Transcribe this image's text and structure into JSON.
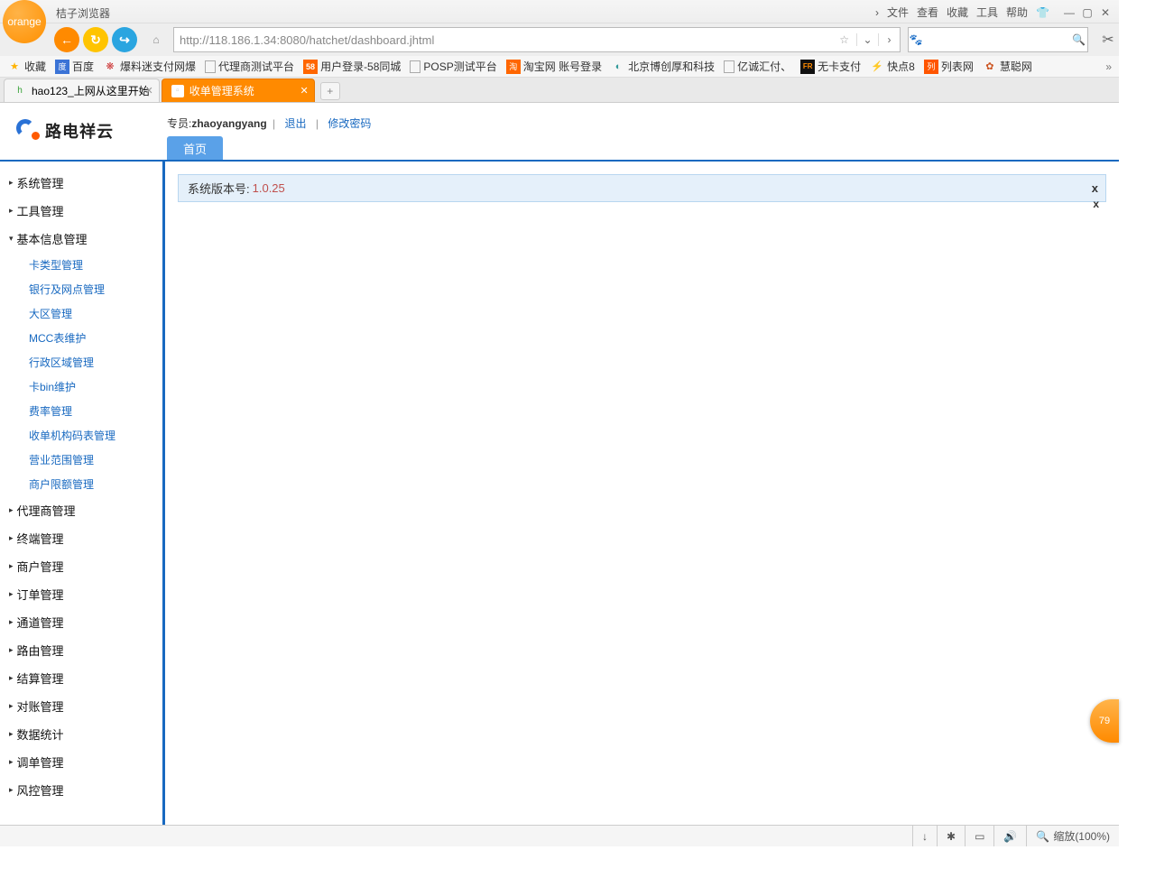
{
  "browser": {
    "name": "orange",
    "title": "桔子浏览器",
    "top_menu": [
      "文件",
      "查看",
      "收藏",
      "工具",
      "帮助"
    ],
    "url": "http://118.186.1.34:8080/hatchet/dashboard.jhtml",
    "url_display_prefix": "http://",
    "url_display_host": "118.186.1.34",
    "url_display_rest": ":8080/hatchet/dashboard.jhtml"
  },
  "bookmarks": {
    "fav_label": "收藏",
    "items": [
      {
        "label": "百度",
        "color": "#3b73d6"
      },
      {
        "label": "爆料迷支付网爆",
        "color": "#cc3333"
      },
      {
        "label": "代理商测试平台",
        "color": "#888"
      },
      {
        "label": "用户登录-58同城",
        "color": "#ff6600",
        "badge": "58"
      },
      {
        "label": "POSP测试平台",
        "color": "#888"
      },
      {
        "label": "淘宝网 账号登录",
        "color": "#ff6600",
        "badge": "淘"
      },
      {
        "label": "北京博创厚和科技",
        "color": "#339999"
      },
      {
        "label": "亿诚汇付、",
        "color": "#888"
      },
      {
        "label": "无卡支付",
        "color": "#222",
        "badge": "FR"
      },
      {
        "label": "快点8",
        "color": "#ff8800"
      },
      {
        "label": "列表网",
        "color": "#ff5500",
        "badge": "列"
      },
      {
        "label": "慧聪网",
        "color": "#cc5522"
      }
    ]
  },
  "tabs": [
    {
      "label": "hao123_上网从这里开始",
      "active": false,
      "favcolor": "#3aa33a"
    },
    {
      "label": "收单管理系统",
      "active": true,
      "favcolor": "#ffffff"
    }
  ],
  "app": {
    "logo_text": "路电祥云",
    "user_prefix": "专员:",
    "username": "zhaoyangyang",
    "logout": "退出",
    "change_pwd": "修改密码",
    "home_tab": "首页",
    "version_label": "系统版本号:",
    "version_value": " 1.0.25",
    "close_x": "x"
  },
  "sidebar": [
    {
      "label": "系统管理",
      "expanded": false
    },
    {
      "label": "工具管理",
      "expanded": false
    },
    {
      "label": "基本信息管理",
      "expanded": true,
      "children": [
        "卡类型管理",
        "银行及网点管理",
        "大区管理",
        "MCC表维护",
        "行政区域管理",
        "卡bin维护",
        "费率管理",
        "收单机构码表管理",
        "营业范围管理",
        "商户限额管理"
      ]
    },
    {
      "label": "代理商管理",
      "expanded": false
    },
    {
      "label": "终端管理",
      "expanded": false
    },
    {
      "label": "商户管理",
      "expanded": false
    },
    {
      "label": "订单管理",
      "expanded": false
    },
    {
      "label": "通道管理",
      "expanded": false
    },
    {
      "label": "路由管理",
      "expanded": false
    },
    {
      "label": "结算管理",
      "expanded": false
    },
    {
      "label": "对账管理",
      "expanded": false
    },
    {
      "label": "数据统计",
      "expanded": false
    },
    {
      "label": "调单管理",
      "expanded": false
    },
    {
      "label": "风控管理",
      "expanded": false
    }
  ],
  "side_badge": "79",
  "status": {
    "zoom": "缩放(100%)"
  }
}
